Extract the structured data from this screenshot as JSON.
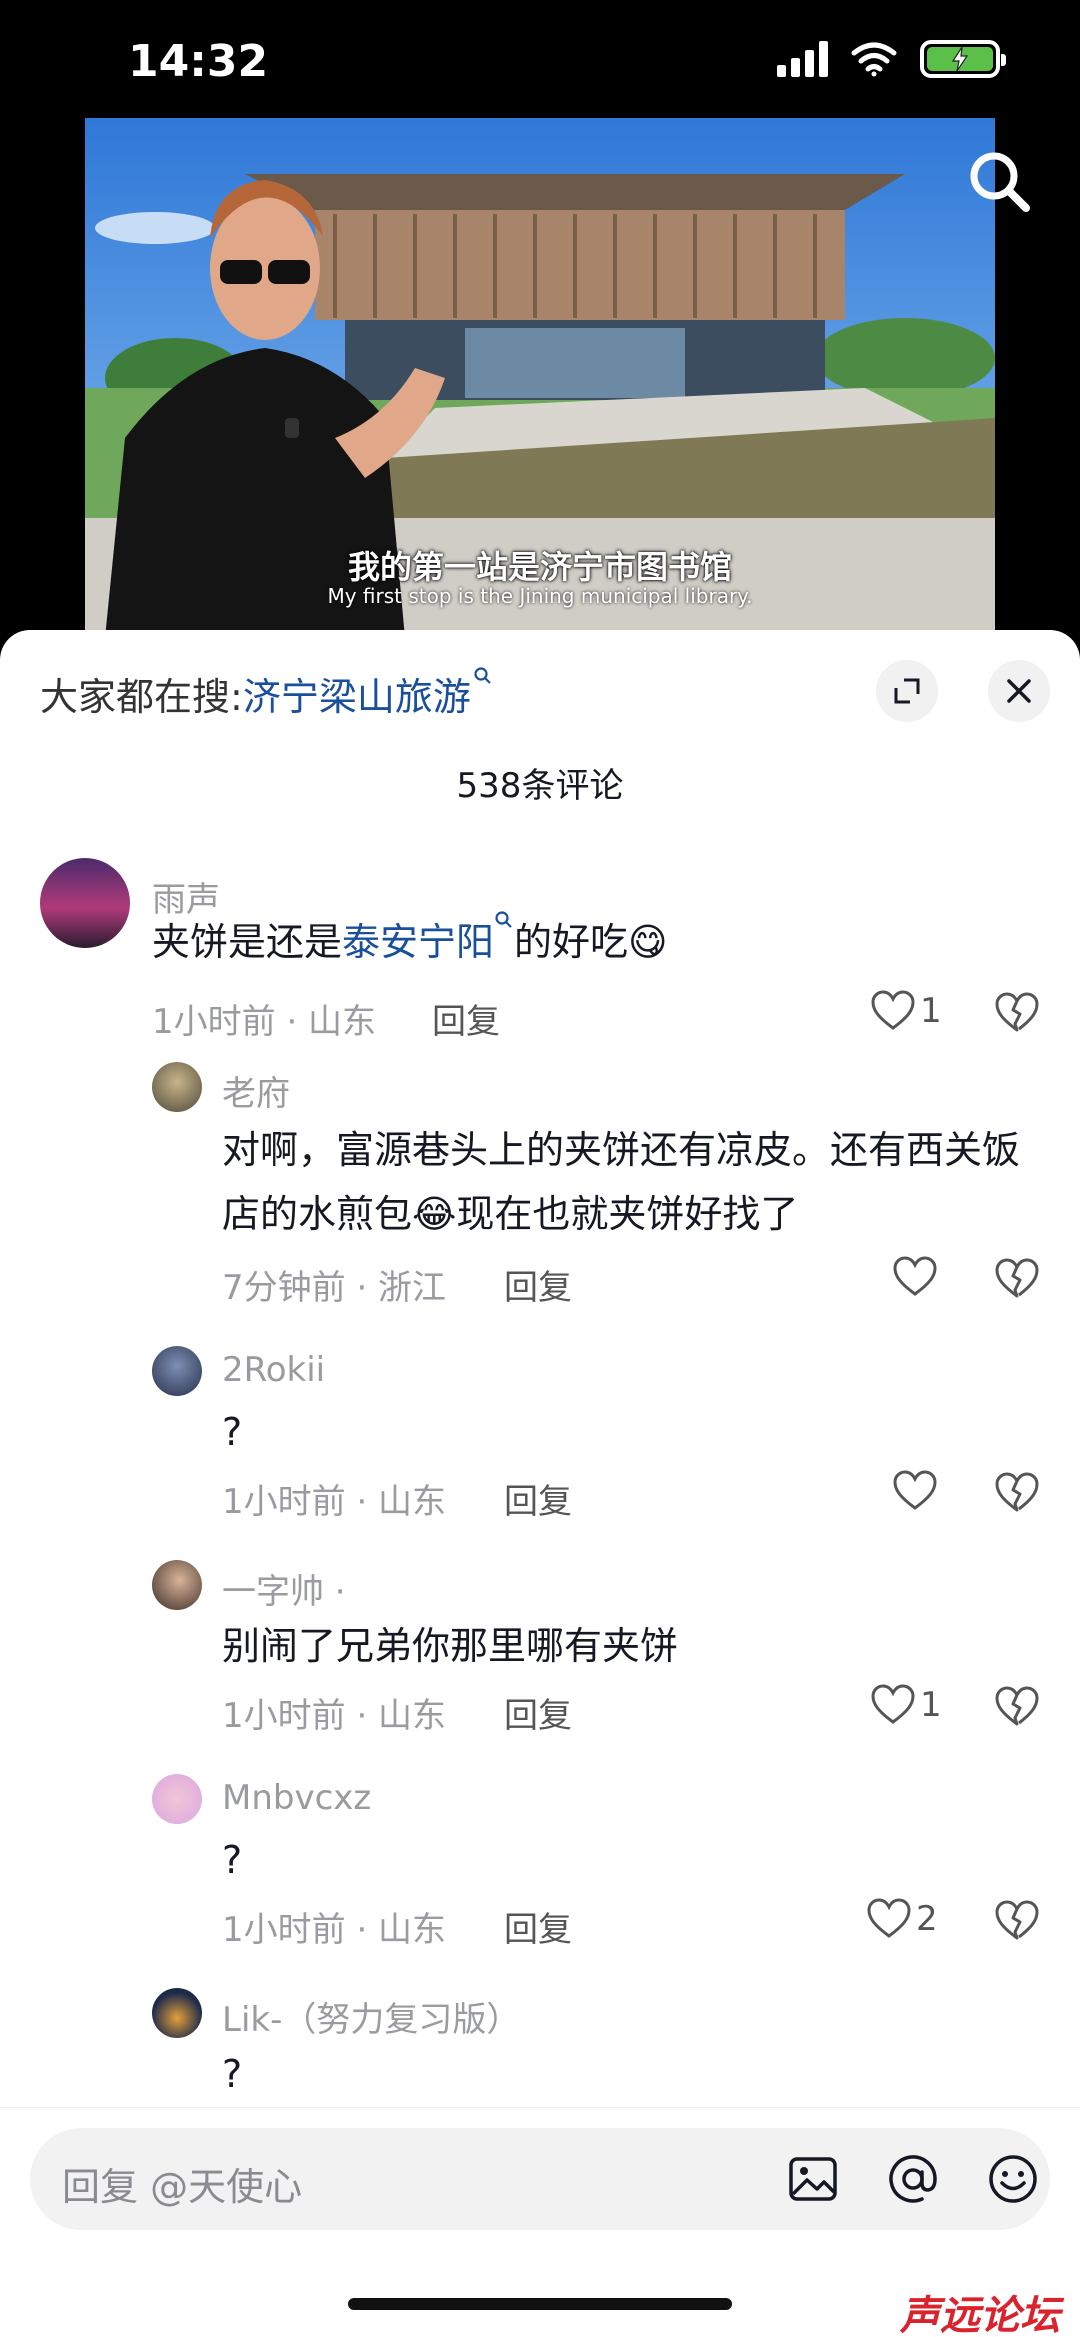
{
  "status": {
    "time": "14:32"
  },
  "video": {
    "subtitle_cn": "我的第一站是济宁市图书馆",
    "subtitle_en": "My first stop is the Jining municipal library."
  },
  "panel": {
    "hot_search_prefix": "大家都在搜:",
    "hot_search_keyword": "济宁梁山旅游",
    "comment_count": "538条评论"
  },
  "comments": [
    {
      "user": "雨声",
      "text_before": "夹饼是还是",
      "text_link": "泰安宁阳",
      "text_after": "的好吃😋",
      "meta": "1小时前 · 山东",
      "reply": "回复",
      "likes": "1"
    },
    {
      "user": "老府",
      "text": "对啊，富源巷头上的夹饼还有凉皮。还有西关饭店的水煎包😂现在也就夹饼好找了",
      "meta": "7分钟前 · 浙江",
      "reply": "回复",
      "likes": ""
    },
    {
      "user": "2Rokii",
      "text": "?",
      "meta": "1小时前 · 山东",
      "reply": "回复",
      "likes": ""
    },
    {
      "user": "一字帅 ·",
      "text": "别闹了兄弟你那里哪有夹饼",
      "meta": "1小时前 · 山东",
      "reply": "回复",
      "likes": "1"
    },
    {
      "user": "Mnbvcxz",
      "text": "?",
      "meta": "1小时前 · 山东",
      "reply": "回复",
      "likes": "2"
    },
    {
      "user": "Lik-（努力复习版）",
      "text": "?"
    }
  ],
  "input": {
    "placeholder": "回复 @天使心"
  },
  "watermark": "声远论坛",
  "colors": {
    "link": "#1a4f9c",
    "battery": "#5ac04a",
    "watermark": "#d9232d"
  }
}
